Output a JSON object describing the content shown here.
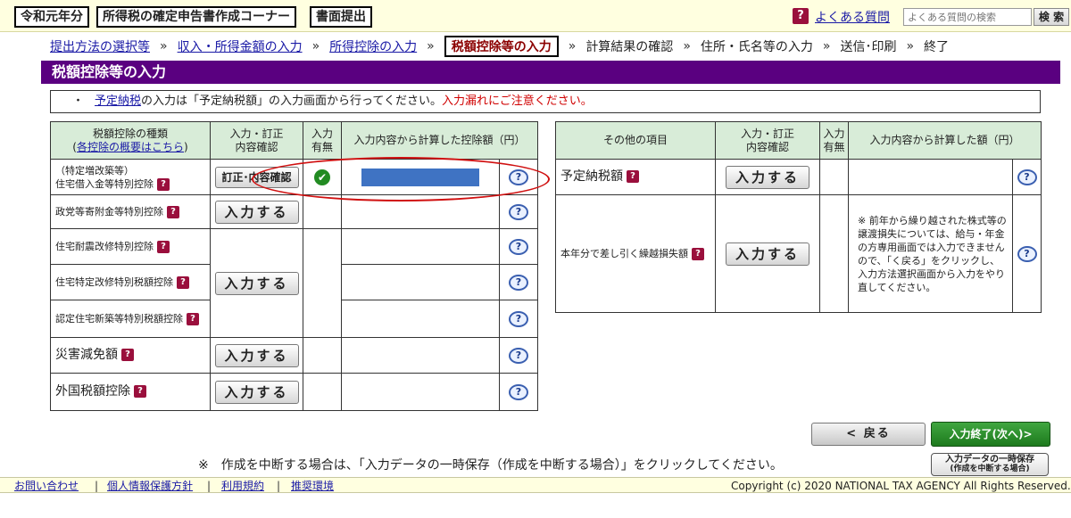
{
  "header": {
    "era_badge": "令和元年分",
    "corner_badge": "所得税の確定申告書作成コーナー",
    "mode_badge": "書面提出",
    "faq_link": "よくある質問",
    "faq_icon": "?",
    "search_placeholder": "よくある質問の検索",
    "search_button": "検 索"
  },
  "breadcrumb": {
    "s1": "提出方法の選択等",
    "s2": "収入・所得金額の入力",
    "s3": "所得控除の入力",
    "s4": "税額控除等の入力",
    "s5": "計算結果の確認",
    "s6": "住所・氏名等の入力",
    "s7": "送信･印刷",
    "s8": "終了",
    "sep": "»"
  },
  "page_title": "税額控除等の入力",
  "notice": {
    "bullet": "・",
    "link": "予定納税",
    "text": "の入力は「予定納税額」の入力画面から行ってください。",
    "warning": "入力漏れにご注意ください。"
  },
  "left_table": {
    "col_type": "税額控除の種類",
    "col_type_link": "各控除の概要はこちら",
    "col_input": "入力・訂正\n内容確認",
    "col_has": "入力\n有無",
    "col_amount": "入力内容から計算した控除額（円）",
    "rows": [
      {
        "label": "（特定増改築等）\n住宅借入金等特別控除",
        "button": "訂正･内容確認",
        "has_input": "✔"
      },
      {
        "label": "政党等寄附金等特別控除",
        "button": "入力する"
      },
      {
        "label": "住宅耐震改修特別控除"
      },
      {
        "label": "住宅特定改修特別税額控除",
        "button": "入力する"
      },
      {
        "label": "認定住宅新築等特別税額控除"
      },
      {
        "label": "災害減免額",
        "button": "入力する"
      },
      {
        "label": "外国税額控除",
        "button": "入力する"
      }
    ]
  },
  "right_table": {
    "col_item": "その他の項目",
    "col_input": "入力・訂正\n内容確認",
    "col_has": "入力\n有無",
    "col_amount": "入力内容から計算した額（円）",
    "rows": [
      {
        "label": "予定納税額",
        "button": "入力する"
      },
      {
        "label": "本年分で差し引く繰越損失額",
        "button": "入力する",
        "note": "※ 前年から繰り越された株式等の譲渡損失については、給与・年金の方専用画面では入力できませんので、「く戻る」をクリックし、入力方法選択画面から入力をやり直してください。"
      }
    ]
  },
  "icons": {
    "help": "?",
    "detail": "?"
  },
  "nav": {
    "back": "< 戻る",
    "next": "入力終了(次へ)>",
    "save_line1": "入力データの一時保存",
    "save_line2": "(作成を中断する場合)"
  },
  "bottom_note": "※　作成を中断する場合は、「入力データの一時保存（作成を中断する場合）」をクリックしてください。",
  "footer": {
    "contact": "お問い合わせ",
    "privacy": "個人情報保護方針",
    "terms": "利用規約",
    "env": "推奨環境",
    "sep": "|",
    "copyright": "Copyright (c) 2020 NATIONAL TAX AGENCY All Rights Reserved."
  },
  "colors": {
    "title_bg": "#5a0080",
    "header_green": "#d8ecd8",
    "help_icon": "#9a0f3c",
    "warning_red": "#d00000",
    "next_green": "#2e8b2e",
    "amount_blue": "#3f73c3",
    "annotation_red": "#d01010"
  }
}
